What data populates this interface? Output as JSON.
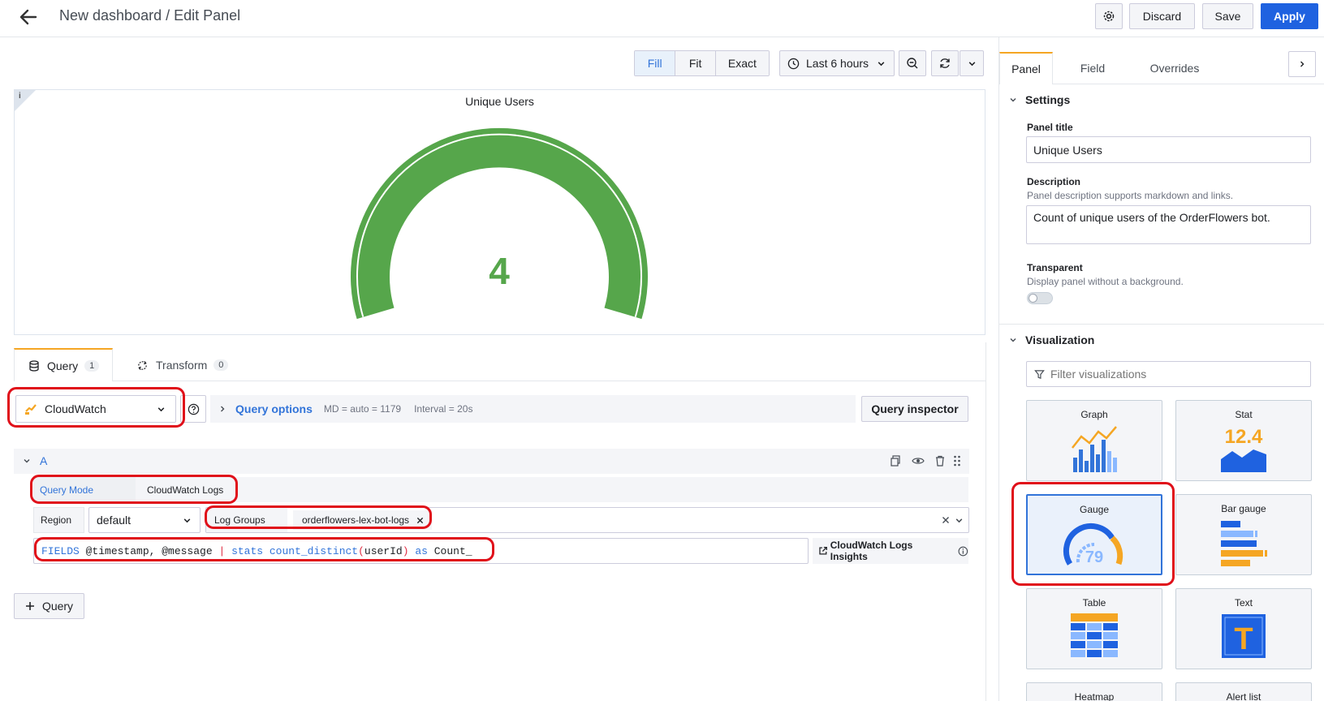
{
  "header": {
    "title": "New dashboard / Edit Panel",
    "discard_label": "Discard",
    "save_label": "Save",
    "apply_label": "Apply"
  },
  "display_modes": [
    "Fill",
    "Fit",
    "Exact"
  ],
  "active_display_mode": "Fill",
  "time_range": "Last 6 hours",
  "panel": {
    "title": "Unique Users",
    "info_glyph": "i",
    "value": "4",
    "gauge_fraction": 1.0,
    "gauge_color": "#56a64b"
  },
  "query_tabs": {
    "query_label": "Query",
    "query_count": "1",
    "transform_label": "Transform",
    "transform_count": "0"
  },
  "datasource": {
    "name": "CloudWatch",
    "query_options_label": "Query options",
    "md_info": "MD = auto = 1179",
    "interval_info": "Interval = 20s",
    "inspector_label": "Query inspector"
  },
  "query_row": {
    "ref_id": "A",
    "query_mode_label": "Query Mode",
    "query_mode_value": "CloudWatch Logs",
    "region_label": "Region",
    "region_value": "default",
    "log_groups_label": "Log Groups",
    "log_group_tag": "orderflowers-lex-bot-logs",
    "query_tokens": {
      "kw1": "FIELDS",
      "t1": " @timestamp, @message ",
      "pipe": "|",
      "kw2": " stats count_distinct",
      "paren_open": "(",
      "t2": "userId",
      "paren_close": ")",
      "kw3": " as",
      "t3": " Count_"
    },
    "insights_label": "CloudWatch Logs Insights"
  },
  "add_query_label": "Query",
  "options_tabs": [
    "Panel",
    "Field",
    "Overrides"
  ],
  "active_options_tab": "Panel",
  "settings": {
    "section_label": "Settings",
    "panel_title_label": "Panel title",
    "panel_title_value": "Unique Users",
    "description_label": "Description",
    "description_hint": "Panel description supports markdown and links.",
    "description_value": "Count of unique users of the OrderFlowers bot.",
    "transparent_label": "Transparent",
    "transparent_hint": "Display panel without a background."
  },
  "visualization": {
    "section_label": "Visualization",
    "filter_placeholder": "Filter visualizations",
    "items": [
      "Graph",
      "Stat",
      "Gauge",
      "Bar gauge",
      "Table",
      "Text",
      "Heatmap",
      "Alert list"
    ],
    "selected": "Gauge",
    "stat_sample": "12.4",
    "gauge_sample": "79",
    "text_sample": "T"
  },
  "colors": {
    "primary": "#1f62e0",
    "link": "#3274d9",
    "highlight": "#e0101a",
    "gauge_green": "#56a64b"
  }
}
